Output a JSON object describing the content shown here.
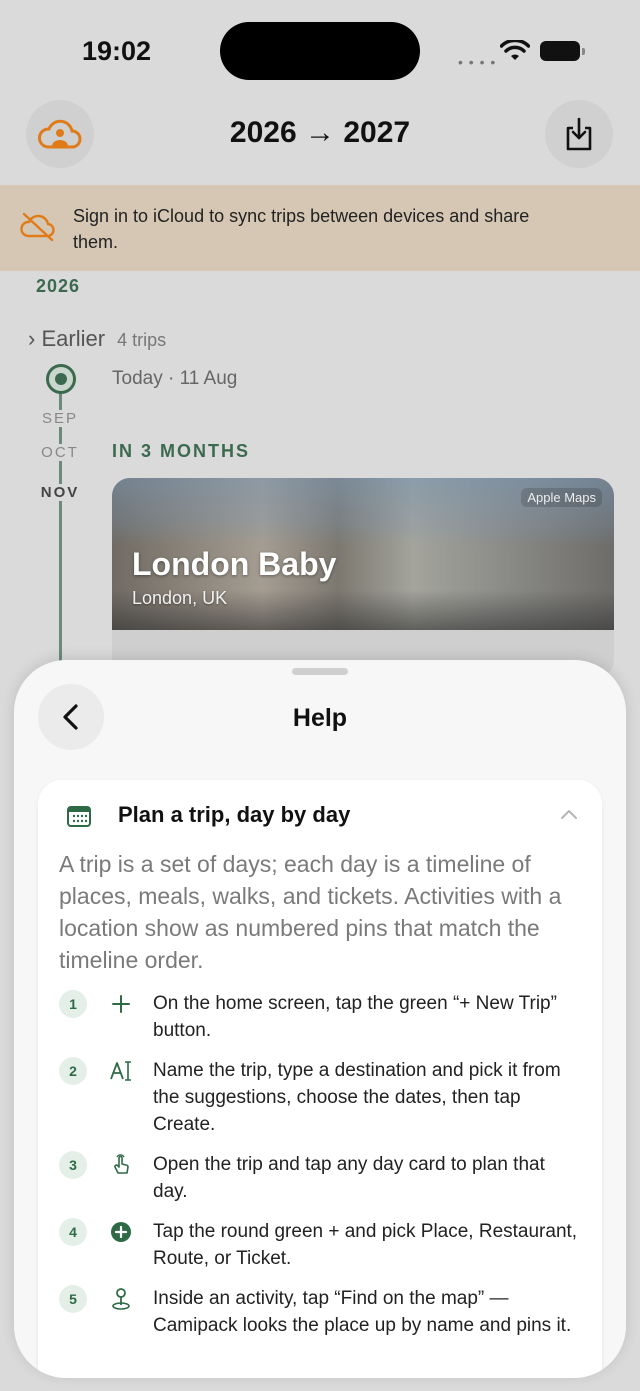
{
  "status": {
    "time": "19:02"
  },
  "header": {
    "title": "2026 → 2027"
  },
  "banner": {
    "text": "Sign in to iCloud to sync trips between devices and share them."
  },
  "timeline": {
    "year": "2026",
    "earlier_label": "Earlier",
    "earlier_count": "4 trips",
    "today_label": "Today · 11 Aug",
    "months": [
      "SEP",
      "OCT",
      "NOV"
    ],
    "upcoming_label": "IN 3 MONTHS"
  },
  "trip_card": {
    "title": "London Baby",
    "location": "London, UK",
    "map_tag": "Apple Maps"
  },
  "sheet": {
    "title": "Help",
    "section_title": "Plan a trip, day by day",
    "section_desc": "A trip is a set of days; each day is a timeline of places, meals, walks, and tickets. Activities with a location show as numbered pins that match the timeline order.",
    "steps": [
      {
        "num": "1",
        "icon": "plus-icon",
        "text": "On the home screen, tap the green “+ New Trip” button."
      },
      {
        "num": "2",
        "icon": "text-cursor-icon",
        "text": "Name the trip, type a destination and pick it from the suggestions, choose the dates, then tap Create."
      },
      {
        "num": "3",
        "icon": "tap-hand-icon",
        "text": "Open the trip and tap any day card to plan that day."
      },
      {
        "num": "4",
        "icon": "plus-circle-icon",
        "text": "Tap the round green + and pick Place, Restaurant, Route, or Ticket."
      },
      {
        "num": "5",
        "icon": "map-pin-icon",
        "text": "Inside an activity, tap “Find on the map” — Camipack looks the place up by name and pins it."
      }
    ]
  },
  "colors": {
    "accent_green": "#2f6a46",
    "banner_bg": "#d6c7b4",
    "icloud_orange": "#e07b1a"
  }
}
